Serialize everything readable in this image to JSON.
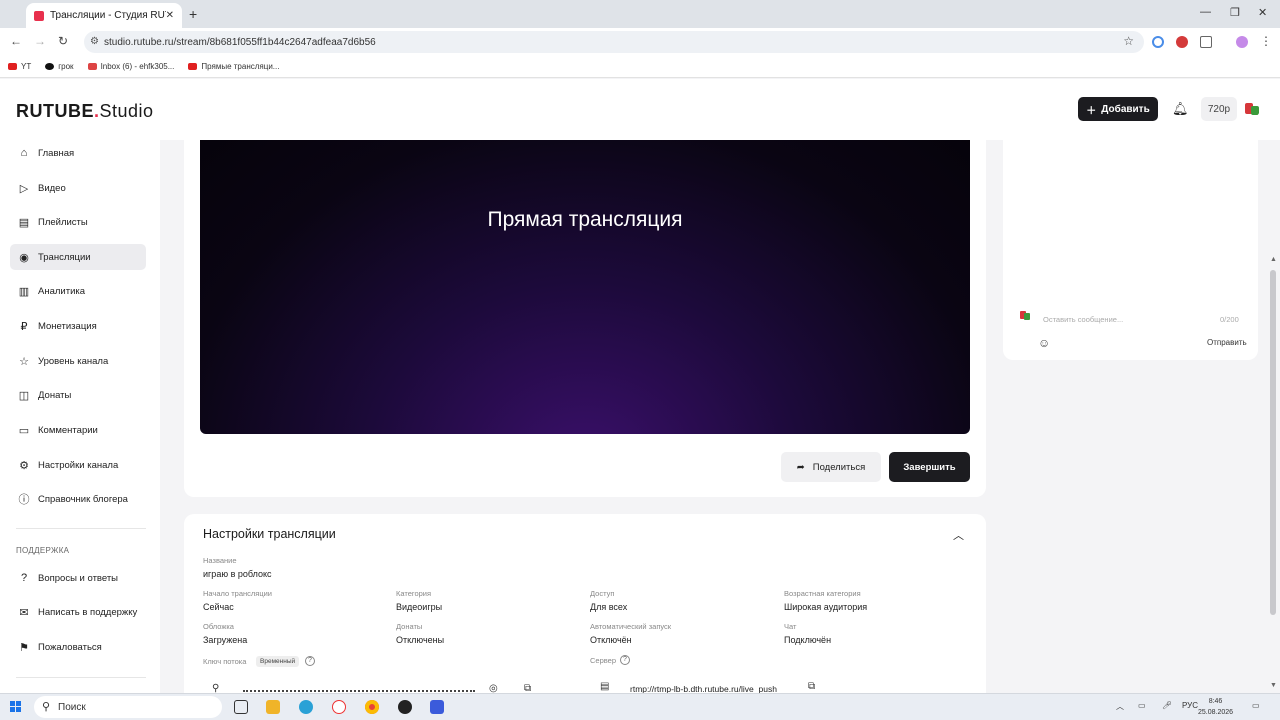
{
  "browser": {
    "tab_title": "Трансляции - Студия RUTUBE",
    "url": "studio.rutube.ru/stream/8b681f055ff1b44c2647adfeaa7d6b56",
    "bookmarks": [
      "YT",
      "грок",
      "Inbox (6) - ehfk305...",
      "Прямые трансляци..."
    ]
  },
  "header": {
    "logo_brand": "RUTUBE",
    "logo_studio": "Studio",
    "add_label": "Добавить",
    "quality": "720p"
  },
  "sidebar": {
    "items": [
      {
        "label": "Главная",
        "icon": "home-icon"
      },
      {
        "label": "Видео",
        "icon": "video-icon"
      },
      {
        "label": "Плейлисты",
        "icon": "playlist-icon"
      },
      {
        "label": "Трансляции",
        "icon": "broadcast-icon"
      },
      {
        "label": "Аналитика",
        "icon": "analytics-icon"
      },
      {
        "label": "Монетизация",
        "icon": "ruble-icon"
      },
      {
        "label": "Уровень канала",
        "icon": "star-icon"
      },
      {
        "label": "Донаты",
        "icon": "donate-icon"
      },
      {
        "label": "Комментарии",
        "icon": "comment-icon"
      },
      {
        "label": "Настройки канала",
        "icon": "gear-icon"
      },
      {
        "label": "Справочник блогера",
        "icon": "info-icon"
      }
    ],
    "support_heading": "ПОДДЕРЖКА",
    "support_items": [
      {
        "label": "Вопросы и ответы",
        "icon": "question-icon"
      },
      {
        "label": "Написать в поддержку",
        "icon": "mail-icon"
      },
      {
        "label": "Пожаловаться",
        "icon": "report-icon"
      }
    ]
  },
  "player": {
    "title": "Прямая трансляция",
    "share_label": "Поделиться",
    "end_label": "Завершить"
  },
  "settings": {
    "title": "Настройки трансляции",
    "name_label": "Название",
    "name_value": "играю в роблокс",
    "start_label": "Начало трансляции",
    "start_value": "Сейчас",
    "category_label": "Категория",
    "category_value": "Видеоигры",
    "access_label": "Доступ",
    "access_value": "Для всех",
    "age_label": "Возрастная категория",
    "age_value": "Широкая аудитория",
    "cover_label": "Обложка",
    "cover_value": "Загружена",
    "donates_label": "Донаты",
    "donates_value": "Отключены",
    "autostart_label": "Автоматический запуск",
    "autostart_value": "Отключён",
    "chat_label": "Чат",
    "chat_value": "Подключён",
    "key_label": "Ключ потока",
    "key_badge": "Временный",
    "server_label": "Сервер",
    "server_value": "rtmp://rtmp-lb-b.dth.rutube.ru/live_push"
  },
  "chat": {
    "placeholder": "Оставить сообщение...",
    "counter": "0/200",
    "send_label": "Отправить"
  },
  "taskbar": {
    "search_label": "Поиск",
    "lang": "РУС",
    "time": "8:46",
    "date": "25.08.2026"
  }
}
